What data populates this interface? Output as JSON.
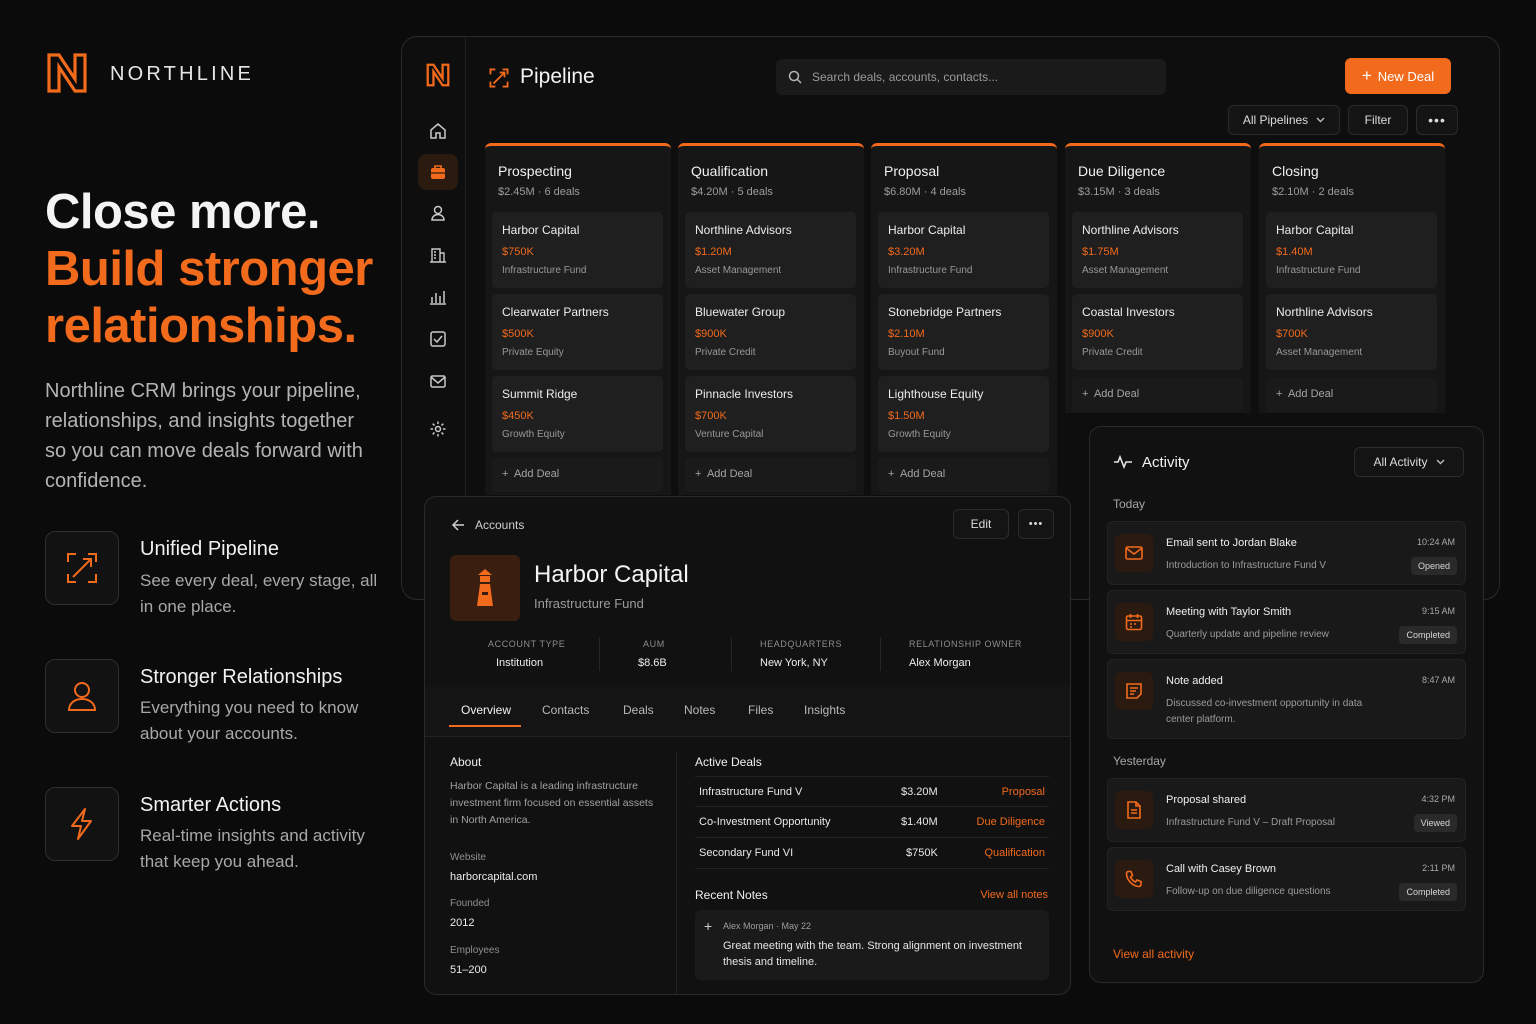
{
  "brand": {
    "name": "NORTHLINE"
  },
  "hero": {
    "line1": "Close more.",
    "line2": "Build stronger relationships.",
    "description": "Northline CRM brings your pipeline, relationships, and insights together so you can move deals forward with confidence."
  },
  "features": [
    {
      "title": "Unified Pipeline",
      "desc": "See every deal, every stage, all in one place.",
      "icon": "pipeline-icon"
    },
    {
      "title": "Stronger Relationships",
      "desc": "Everything you need to know about your accounts.",
      "icon": "user-icon"
    },
    {
      "title": "Smarter Actions",
      "desc": "Real-time insights and activity that keep you ahead.",
      "icon": "bolt-icon"
    }
  ],
  "pipeline": {
    "title": "Pipeline",
    "search_placeholder": "Search deals, accounts, contacts...",
    "new_deal": "New Deal",
    "all_pipelines": "All Pipelines",
    "filter": "Filter",
    "add_deal": "Add Deal",
    "columns": [
      {
        "name": "Prospecting",
        "meta": "$2.45M · 6 deals",
        "cards": [
          {
            "name": "Harbor Capital",
            "amount": "$750K",
            "type": "Infrastructure Fund"
          },
          {
            "name": "Clearwater Partners",
            "amount": "$500K",
            "type": "Private Equity"
          },
          {
            "name": "Summit Ridge",
            "amount": "$450K",
            "type": "Growth Equity"
          }
        ]
      },
      {
        "name": "Qualification",
        "meta": "$4.20M · 5 deals",
        "cards": [
          {
            "name": "Northline Advisors",
            "amount": "$1.20M",
            "type": "Asset Management"
          },
          {
            "name": "Bluewater Group",
            "amount": "$900K",
            "type": "Private Credit"
          },
          {
            "name": "Pinnacle Investors",
            "amount": "$700K",
            "type": "Venture Capital"
          }
        ]
      },
      {
        "name": "Proposal",
        "meta": "$6.80M · 4 deals",
        "cards": [
          {
            "name": "Harbor Capital",
            "amount": "$3.20M",
            "type": "Infrastructure Fund"
          },
          {
            "name": "Stonebridge Partners",
            "amount": "$2.10M",
            "type": "Buyout Fund"
          },
          {
            "name": "Lighthouse Equity",
            "amount": "$1.50M",
            "type": "Growth Equity"
          }
        ]
      },
      {
        "name": "Due Diligence",
        "meta": "$3.15M · 3 deals",
        "cards": [
          {
            "name": "Northline Advisors",
            "amount": "$1.75M",
            "type": "Asset Management"
          },
          {
            "name": "Coastal Investors",
            "amount": "$900K",
            "type": "Private Credit"
          }
        ]
      },
      {
        "name": "Closing",
        "meta": "$2.10M · 2 deals",
        "cards": [
          {
            "name": "Harbor Capital",
            "amount": "$1.40M",
            "type": "Infrastructure Fund"
          },
          {
            "name": "Northline Advisors",
            "amount": "$700K",
            "type": "Asset Management"
          }
        ]
      }
    ]
  },
  "account": {
    "back": "Accounts",
    "edit": "Edit",
    "name": "Harbor Capital",
    "subtitle": "Infrastructure Fund",
    "stats": [
      {
        "label": "ACCOUNT TYPE",
        "value": "Institution"
      },
      {
        "label": "AUM",
        "value": "$8.6B"
      },
      {
        "label": "HEADQUARTERS",
        "value": "New York, NY"
      },
      {
        "label": "RELATIONSHIP OWNER",
        "value": "Alex Morgan"
      }
    ],
    "tabs": [
      "Overview",
      "Contacts",
      "Deals",
      "Notes",
      "Files",
      "Insights"
    ],
    "about_title": "About",
    "about": "Harbor Capital is a leading infrastructure investment firm focused on essential assets in North America.",
    "website_label": "Website",
    "website": "harborcapital.com",
    "founded_label": "Founded",
    "founded": "2012",
    "employees_label": "Employees",
    "employees": "51–200",
    "active_deals_title": "Active Deals",
    "deals": [
      {
        "name": "Infrastructure Fund V",
        "amount": "$3.20M",
        "stage": "Proposal"
      },
      {
        "name": "Co-Investment Opportunity",
        "amount": "$1.40M",
        "stage": "Due Diligence"
      },
      {
        "name": "Secondary Fund VI",
        "amount": "$750K",
        "stage": "Qualification"
      }
    ],
    "notes_title": "Recent Notes",
    "view_notes": "View all notes",
    "note_author": "Alex Morgan",
    "note_date": "May 22",
    "note_text": "Great meeting with the team. Strong alignment on investment thesis and timeline."
  },
  "activity": {
    "title": "Activity",
    "filter": "All Activity",
    "today": "Today",
    "yesterday": "Yesterday",
    "view_all": "View all activity",
    "items": [
      {
        "title": "Email sent to Jordan Blake",
        "sub": "Introduction to Infrastructure Fund V",
        "time": "10:24 AM",
        "badge": "Opened",
        "icon": "mail-icon"
      },
      {
        "title": "Meeting with Taylor Smith",
        "sub": "Quarterly update and pipeline review",
        "time": "9:15 AM",
        "badge": "Completed",
        "icon": "calendar-icon"
      },
      {
        "title": "Note added",
        "sub": "Discussed co-investment opportunity in data center platform.",
        "time": "8:47 AM",
        "badge": "",
        "icon": "note-icon"
      },
      {
        "title": "Proposal shared",
        "sub": "Infrastructure Fund V – Draft Proposal",
        "time": "4:32 PM",
        "badge": "Viewed",
        "icon": "file-icon"
      },
      {
        "title": "Call with Casey Brown",
        "sub": "Follow-up on due diligence questions",
        "time": "2:11 PM",
        "badge": "Completed",
        "icon": "phone-icon"
      }
    ]
  },
  "colors": {
    "accent": "#f26a1b",
    "background": "#0b0b0c"
  }
}
